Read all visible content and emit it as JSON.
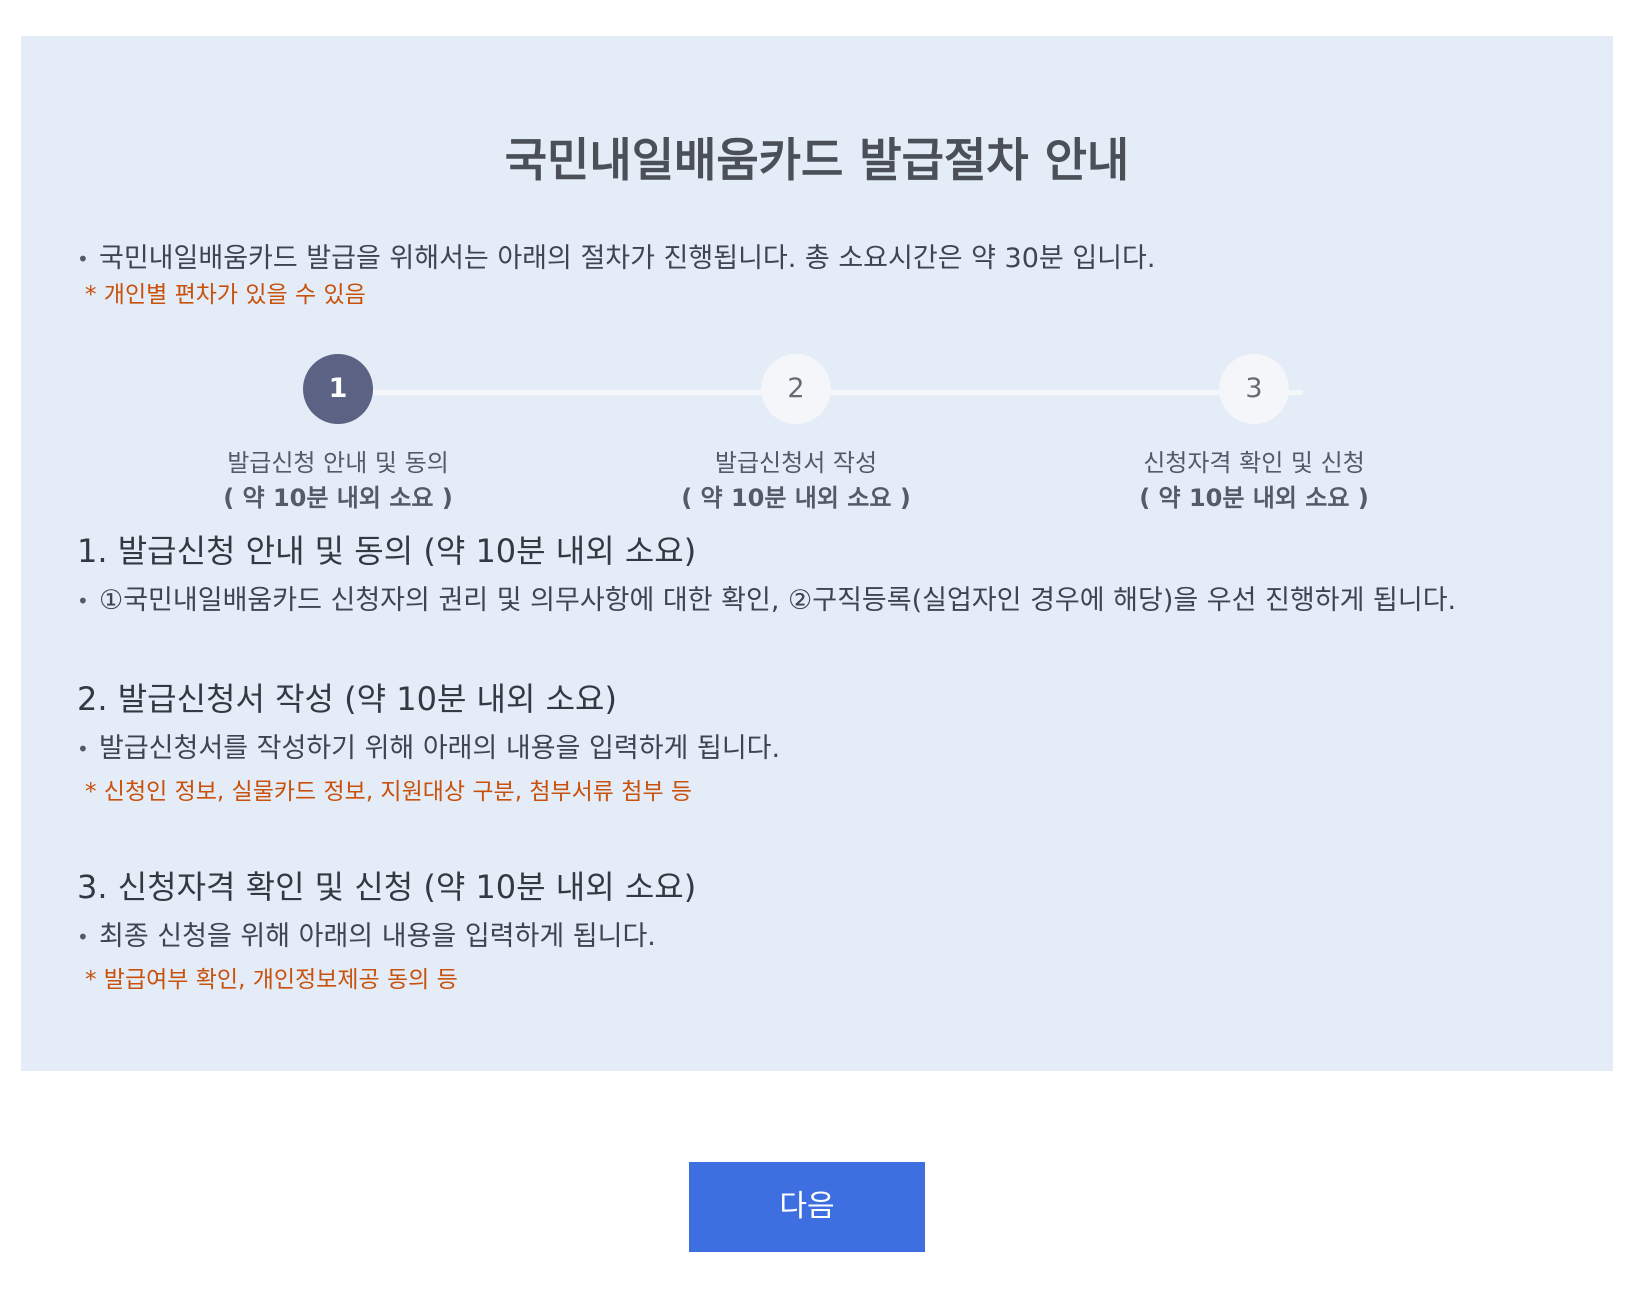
{
  "title": "국민내일배움카드 발급절차 안내",
  "intro": {
    "bullet": "•",
    "text": "국민내일배움카드 발급을 위해서는 아래의 절차가 진행됩니다. 총 소요시간은 약 30분 입니다.",
    "note": "* 개인별 편차가 있을 수 있음"
  },
  "steps": [
    {
      "number": "1",
      "label": "발급신청 안내 및 동의",
      "time": "( 약 10분 내외 소요 )",
      "active": true
    },
    {
      "number": "2",
      "label": "발급신청서 작성",
      "time": "( 약 10분 내외 소요 )",
      "active": false
    },
    {
      "number": "3",
      "label": "신청자격 확인 및 신청",
      "time": "( 약 10분 내외 소요 )",
      "active": false
    }
  ],
  "sections": [
    {
      "title": "1. 발급신청 안내 및 동의 (약 10분 내외 소요)",
      "text": "①국민내일배움카드 신청자의 권리 및 의무사항에 대한 확인, ②구직등록(실업자인 경우에 해당)을 우선 진행하게 됩니다."
    },
    {
      "title": "2. 발급신청서 작성 (약 10분 내외 소요)",
      "text": "발급신청서를 작성하기 위해 아래의 내용을 입력하게 됩니다.",
      "note": "* 신청인 정보, 실물카드 정보, 지원대상 구분, 첨부서류 첨부 등"
    },
    {
      "title": "3. 신청자격 확인 및 신청 (약 10분 내외 소요)",
      "text": "최종 신청을 위해 아래의 내용을 입력하게 됩니다.",
      "note": "* 발급여부 확인, 개인정보제공 동의 등"
    }
  ],
  "next_button": "다음",
  "colors": {
    "panel_background": "#e4ecf7",
    "note_text": "#c9510c",
    "active_step": "#5b6283",
    "inactive_step": "#f4f6fa",
    "button": "#3d6fe0"
  }
}
